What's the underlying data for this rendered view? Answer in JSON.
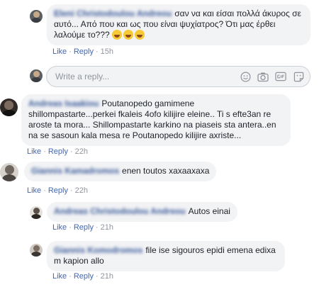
{
  "comments": [
    {
      "author": "Eleni Christodoulou Andreou",
      "text": "σαν να και είσαι πολλά άκυρος σε αυτό... Από που και ως που είναι ψυχίατρος? Ότι μας έρθει λαλούμε το???",
      "like": "Like",
      "reply": "Reply",
      "time": "15h"
    },
    {
      "author": "Andreas Isaakiou",
      "text": "Poutanopedo gamimene shillompastarte...perkei fkaleis 4ofo kilijire eleine.. Ti s efte3an re aroste ta mora... Shillompastarte karkino na piaseis sta antera..en na se sasoun kala mesa re Poutanopedo kilijire axriste...",
      "like": "Like",
      "reply": "Reply",
      "time": "22h"
    },
    {
      "author": "Giannis Kamadromos",
      "text": "enen toutos xaxaaxaxa",
      "like": "Like",
      "reply": "Reply",
      "time": "22h"
    },
    {
      "author": "Andreas Christodoulou Andreou",
      "text": "Autos einai",
      "like": "Like",
      "reply": "Reply",
      "time": "21h"
    },
    {
      "author": "Giannis Komodromos",
      "text": "file ise sigouros epidi emena edixa m kapion allo",
      "like": "Like",
      "reply": "Reply",
      "time": "21h"
    }
  ],
  "reply_box": {
    "placeholder": "Write a reply..."
  },
  "icons": [
    "emoji-icon",
    "camera-icon",
    "gif-icon",
    "sticker-icon"
  ]
}
